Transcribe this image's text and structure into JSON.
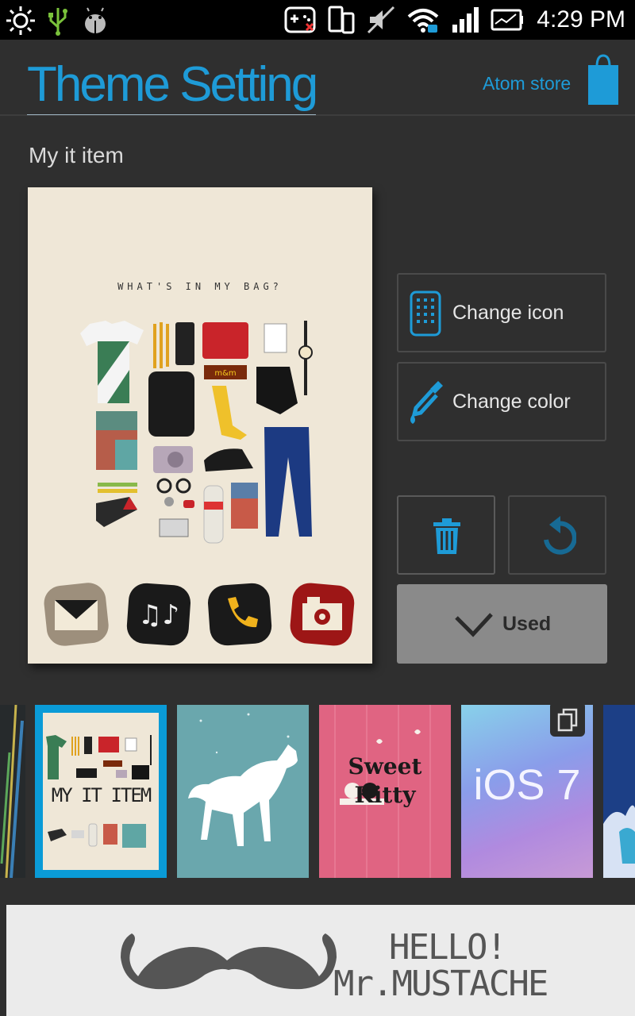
{
  "status_bar": {
    "time": "4:29 PM",
    "icons": [
      "brightness-icon",
      "usb-icon",
      "android-debug-icon",
      "controller-icon",
      "phone-devices-icon",
      "mute-icon",
      "wifi-icon",
      "signal-icon",
      "battery-icon"
    ]
  },
  "header": {
    "title": "Theme Setting",
    "store_label": "Atom store",
    "store_icon": "shopping-bag-icon"
  },
  "theme": {
    "name": "My it item",
    "preview_heading": "WHAT'S IN MY BAG?",
    "dock_icons": [
      "mail-icon",
      "music-icon",
      "phone-icon",
      "camera-icon"
    ]
  },
  "actions": {
    "change_icon_label": "Change icon",
    "change_color_label": "Change color",
    "delete_icon": "trash-icon",
    "reset_icon": "reset-icon",
    "used_label": "Used"
  },
  "themes_strip": [
    {
      "label": "MY IT ITEM",
      "selected": true
    },
    {
      "label": "",
      "selected": false
    },
    {
      "label": "Sweet Kitty",
      "selected": false
    },
    {
      "label": "iOS 7",
      "selected": false
    }
  ],
  "banner": {
    "line1": "HELLO!",
    "line2": "Mr.MUSTACHE"
  },
  "colors": {
    "accent": "#1e9bd7",
    "background": "#2f2f2f",
    "used_button": "#8a8a8a"
  }
}
